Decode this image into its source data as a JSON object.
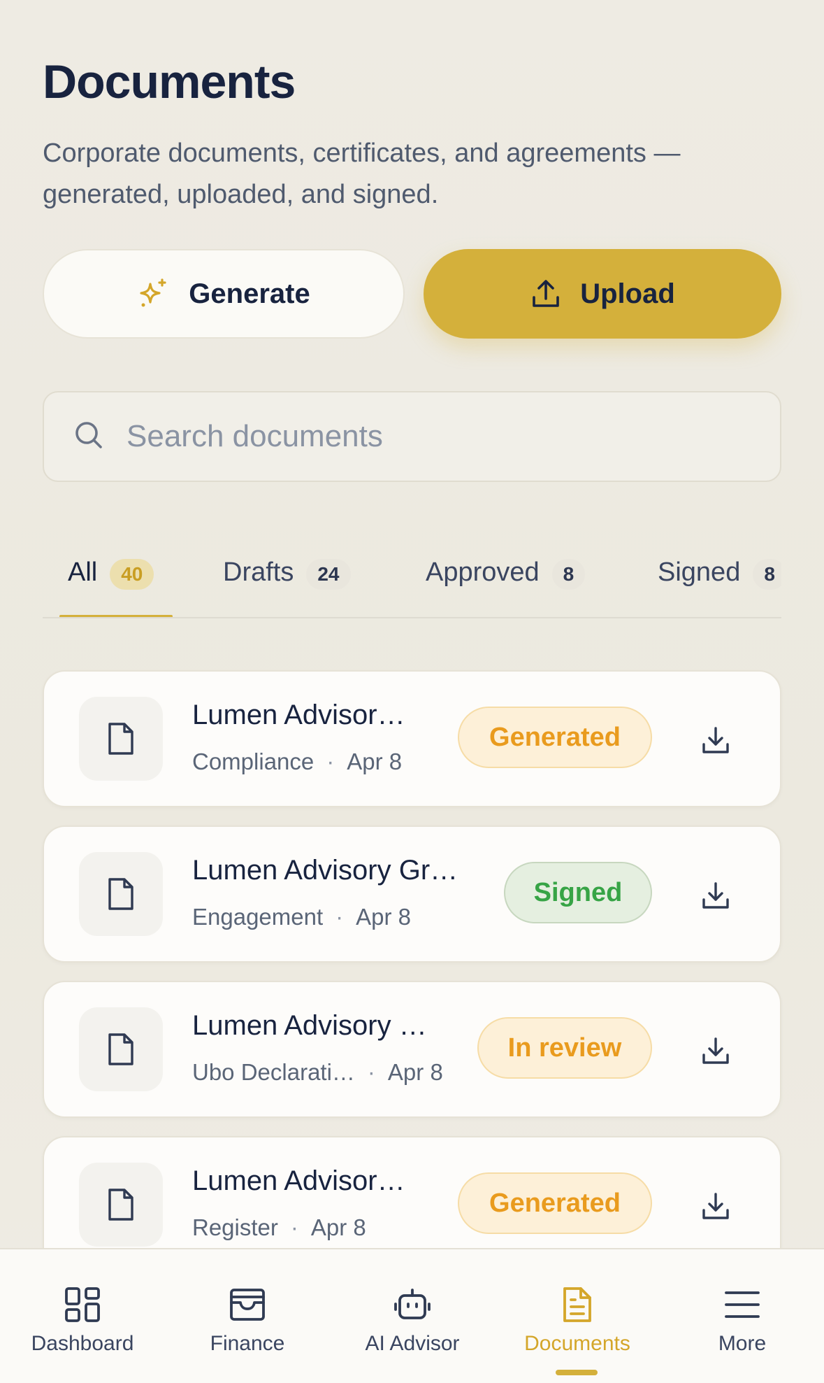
{
  "header": {
    "title": "Documents",
    "subtitle": "Corporate documents, certificates, and agreements — generated, uploaded, and signed."
  },
  "actions": {
    "generate_label": "Generate",
    "upload_label": "Upload"
  },
  "search": {
    "placeholder": "Search documents",
    "value": ""
  },
  "tabs": [
    {
      "label": "All",
      "count": "40",
      "active": true
    },
    {
      "label": "Drafts",
      "count": "24",
      "active": false
    },
    {
      "label": "Approved",
      "count": "8",
      "active": false
    },
    {
      "label": "Signed",
      "count": "8",
      "active": false
    }
  ],
  "documents": [
    {
      "name": "Lumen Advisor…",
      "category": "Compliance",
      "date": "Apr 8",
      "status": "Generated"
    },
    {
      "name": "Lumen Advisory Gr…",
      "category": "Engagement",
      "date": "Apr 8",
      "status": "Signed"
    },
    {
      "name": "Lumen Advisory …",
      "category": "Ubo Declarati…",
      "date": "Apr 8",
      "status": "In review"
    },
    {
      "name": "Lumen Advisor…",
      "category": "Register",
      "date": "Apr 8",
      "status": "Generated"
    }
  ],
  "meta_separator": "·",
  "nav": [
    {
      "label": "Dashboard",
      "icon": "grid-icon",
      "active": false
    },
    {
      "label": "Finance",
      "icon": "wallet-icon",
      "active": false
    },
    {
      "label": "AI Advisor",
      "icon": "robot-icon",
      "active": false
    },
    {
      "label": "Documents",
      "icon": "document-icon",
      "active": true
    },
    {
      "label": "More",
      "icon": "menu-icon",
      "active": false
    }
  ],
  "colors": {
    "accent": "#d4b03b",
    "text_primary": "#18233f",
    "status_generated": "#e99b1e",
    "status_signed": "#37a446",
    "status_review": "#e99b1e"
  }
}
